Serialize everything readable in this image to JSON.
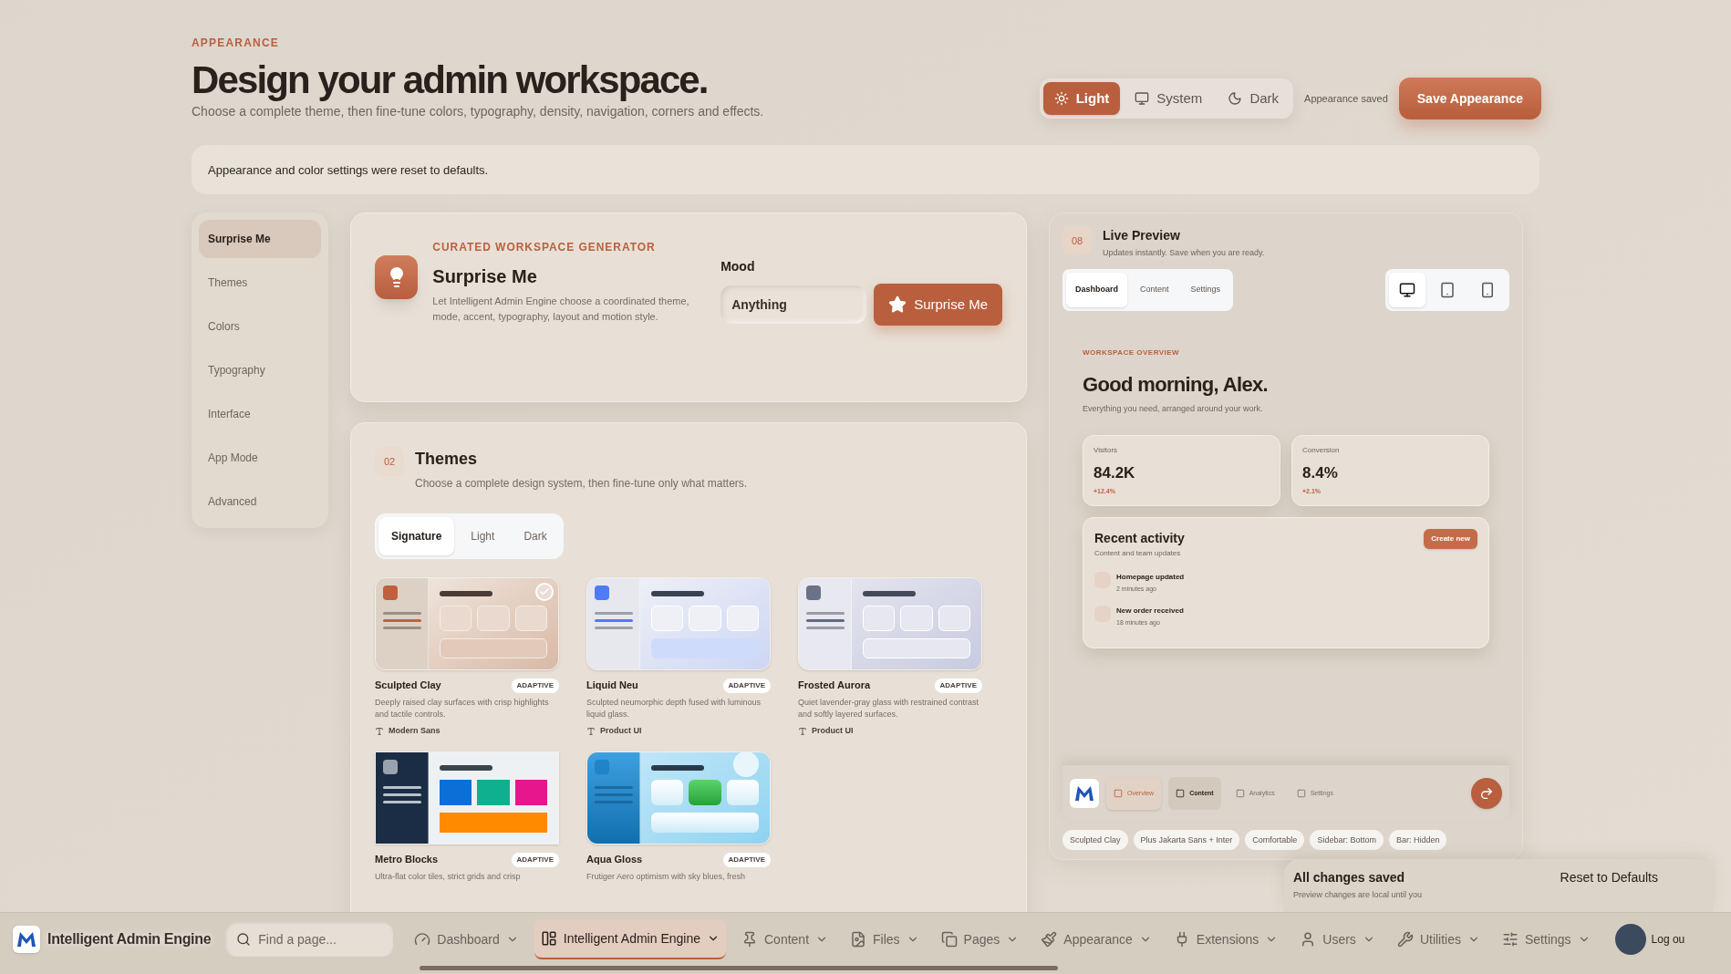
{
  "header": {
    "eyebrow": "APPEARANCE",
    "title": "Design your admin workspace.",
    "subtitle": "Choose a complete theme, then fine-tune colors, typography, density, navigation, corners and effects."
  },
  "mode_switch": [
    {
      "label": "Light",
      "kind": "light",
      "selected": true
    },
    {
      "label": "System",
      "kind": "system",
      "selected": false
    },
    {
      "label": "Dark",
      "kind": "dark",
      "selected": false
    }
  ],
  "save_status": "Appearance saved",
  "save_button": "Save Appearance",
  "notice": "Appearance and color settings were reset to defaults.",
  "sidebar": {
    "items": [
      {
        "label": "Surprise Me",
        "selected": true
      },
      {
        "label": "Themes",
        "selected": false
      },
      {
        "label": "Colors",
        "selected": false
      },
      {
        "label": "Typography",
        "selected": false
      },
      {
        "label": "Interface",
        "selected": false
      },
      {
        "label": "App Mode",
        "selected": false
      },
      {
        "label": "Advanced",
        "selected": false
      }
    ]
  },
  "surprise": {
    "eyebrow": "CURATED WORKSPACE GENERATOR",
    "title": "Surprise Me",
    "description": "Let Intelligent Admin Engine choose a coordinated theme, mode, accent, typography, layout and motion style.",
    "mood_label": "Mood",
    "mood_value": "Anything",
    "button": "Surprise Me"
  },
  "themes": {
    "number": "02",
    "title": "Themes",
    "subtitle": "Choose a complete design system, then fine-tune only what matters.",
    "tabs": [
      {
        "label": "Signature",
        "selected": true
      },
      {
        "label": "Light",
        "selected": false
      },
      {
        "label": "Dark",
        "selected": false
      }
    ],
    "cards": [
      {
        "name": "Sculpted Clay",
        "badge": "ADAPTIVE",
        "description": "Deeply raised clay surfaces with crisp highlights and tactile controls.",
        "font": "Modern Sans",
        "kind": "clay",
        "selected": true
      },
      {
        "name": "Liquid Neu",
        "badge": "ADAPTIVE",
        "description": "Sculpted neumorphic depth fused with luminous liquid glass.",
        "font": "Product UI",
        "kind": "liquid",
        "selected": false
      },
      {
        "name": "Frosted Aurora",
        "badge": "ADAPTIVE",
        "description": "Quiet lavender-gray glass with restrained contrast and softly layered surfaces.",
        "font": "Product UI",
        "kind": "frosted",
        "selected": false
      },
      {
        "name": "Metro Blocks",
        "badge": "ADAPTIVE",
        "description": "Ultra-flat color tiles, strict grids and crisp",
        "kind": "metro",
        "selected": false
      },
      {
        "name": "Aqua Gloss",
        "badge": "ADAPTIVE",
        "description": "Frutiger Aero optimism with sky blues, fresh",
        "kind": "aqua",
        "selected": false
      }
    ]
  },
  "preview": {
    "number": "08",
    "title": "Live Preview",
    "subtitle": "Updates instantly. Save when you are ready.",
    "tabs": [
      {
        "label": "Dashboard",
        "selected": true
      },
      {
        "label": "Content",
        "selected": false
      },
      {
        "label": "Settings",
        "selected": false
      }
    ],
    "devices": [
      {
        "kind": "desktop",
        "selected": true
      },
      {
        "kind": "tablet",
        "selected": false
      },
      {
        "kind": "phone",
        "selected": false
      }
    ],
    "eyebrow": "WORKSPACE OVERVIEW",
    "greeting": "Good morning, Alex.",
    "tagline": "Everything you need, arranged around your work.",
    "stats": [
      {
        "label": "Visitors",
        "value": "84.2K",
        "delta": "+12.4%"
      },
      {
        "label": "Conversion",
        "value": "8.4%",
        "delta": "+2.1%"
      }
    ],
    "activity": {
      "title": "Recent activity",
      "subtitle": "Content and team updates",
      "button": "Create new",
      "items": [
        {
          "title": "Homepage updated",
          "time": "2 minutes ago"
        },
        {
          "title": "New order received",
          "time": "18 minutes ago"
        }
      ]
    },
    "nav": [
      {
        "label": "Overview",
        "selected": true,
        "hovered": false
      },
      {
        "label": "Content",
        "selected": false,
        "hovered": true
      },
      {
        "label": "Analytics",
        "selected": false,
        "hovered": false
      },
      {
        "label": "Settings",
        "selected": false,
        "hovered": false
      }
    ],
    "chips": [
      "Sculpted Clay",
      "Plus Jakarta Sans + Inter",
      "Comfortable",
      "Sidebar: Bottom",
      "Bar: Hidden"
    ]
  },
  "save_panel": {
    "title": "All changes saved",
    "note": "Preview changes are local until you",
    "reset": "Reset to Defaults"
  },
  "navbar": {
    "brand": "Intelligent Admin Engine",
    "search_placeholder": "Find a page...",
    "items": [
      {
        "label": "Dashboard",
        "kind": "gauge",
        "selected": false
      },
      {
        "label": "Intelligent Admin Engine",
        "kind": "blocks",
        "selected": true
      },
      {
        "label": "Content",
        "kind": "pin",
        "selected": false
      },
      {
        "label": "Files",
        "kind": "files",
        "selected": false
      },
      {
        "label": "Pages",
        "kind": "pages",
        "selected": false
      },
      {
        "label": "Appearance",
        "kind": "brush",
        "selected": false
      },
      {
        "label": "Extensions",
        "kind": "plug",
        "selected": false
      },
      {
        "label": "Users",
        "kind": "user",
        "selected": false
      },
      {
        "label": "Utilities",
        "kind": "wrench",
        "selected": false
      },
      {
        "label": "Settings",
        "kind": "sliders",
        "selected": false
      }
    ],
    "logout": "Log ou"
  }
}
